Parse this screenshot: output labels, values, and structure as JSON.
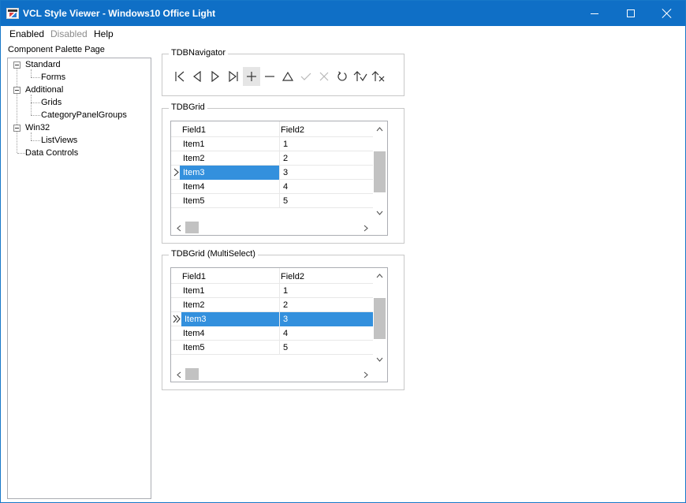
{
  "window": {
    "title": "VCL Style Viewer - Windows10 Office Light",
    "controls": [
      "minimize",
      "maximize",
      "close"
    ]
  },
  "menu": {
    "enabled": "Enabled",
    "disabled": "Disabled",
    "help": "Help"
  },
  "palette": {
    "label": "Component Palette Page",
    "tree": [
      {
        "label": "Standard",
        "children": [
          "Forms"
        ]
      },
      {
        "label": "Additional",
        "children": [
          "Grids",
          "CategoryPanelGroups"
        ]
      },
      {
        "label": "Win32",
        "children": [
          "ListViews"
        ]
      },
      {
        "label": "Data Controls",
        "children": []
      }
    ]
  },
  "navigator": {
    "title": "TDBNavigator",
    "buttons": [
      {
        "name": "first-icon",
        "enabled": true
      },
      {
        "name": "prior-icon",
        "enabled": true
      },
      {
        "name": "next-icon",
        "enabled": true
      },
      {
        "name": "last-icon",
        "enabled": true
      },
      {
        "name": "insert-icon",
        "enabled": true,
        "hot": true
      },
      {
        "name": "delete-icon",
        "enabled": true
      },
      {
        "name": "edit-icon",
        "enabled": true
      },
      {
        "name": "post-icon",
        "enabled": false
      },
      {
        "name": "cancel-icon",
        "enabled": false
      },
      {
        "name": "refresh-icon",
        "enabled": true
      },
      {
        "name": "apply-updates-icon",
        "enabled": true
      },
      {
        "name": "cancel-updates-icon",
        "enabled": true
      }
    ]
  },
  "grid1": {
    "title": "TDBGrid",
    "columns": [
      "Field1",
      "Field2"
    ],
    "rows": [
      [
        "Item1",
        "1"
      ],
      [
        "Item2",
        "2"
      ],
      [
        "Item3",
        "3"
      ],
      [
        "Item4",
        "4"
      ],
      [
        "Item5",
        "5"
      ]
    ],
    "selected_row": 2,
    "indicator_glyph": ">"
  },
  "grid2": {
    "title": "TDBGrid (MultiSelect)",
    "columns": [
      "Field1",
      "Field2"
    ],
    "rows": [
      [
        "Item1",
        "1"
      ],
      [
        "Item2",
        "2"
      ],
      [
        "Item3",
        "3"
      ],
      [
        "Item4",
        "4"
      ],
      [
        "Item5",
        "5"
      ]
    ],
    "selected_row": 2,
    "indicator_glyph": ">>"
  },
  "colors": {
    "titlebar": "#0f6fc6",
    "selection": "#3390dd",
    "disabled_text": "#8c8c8c"
  }
}
